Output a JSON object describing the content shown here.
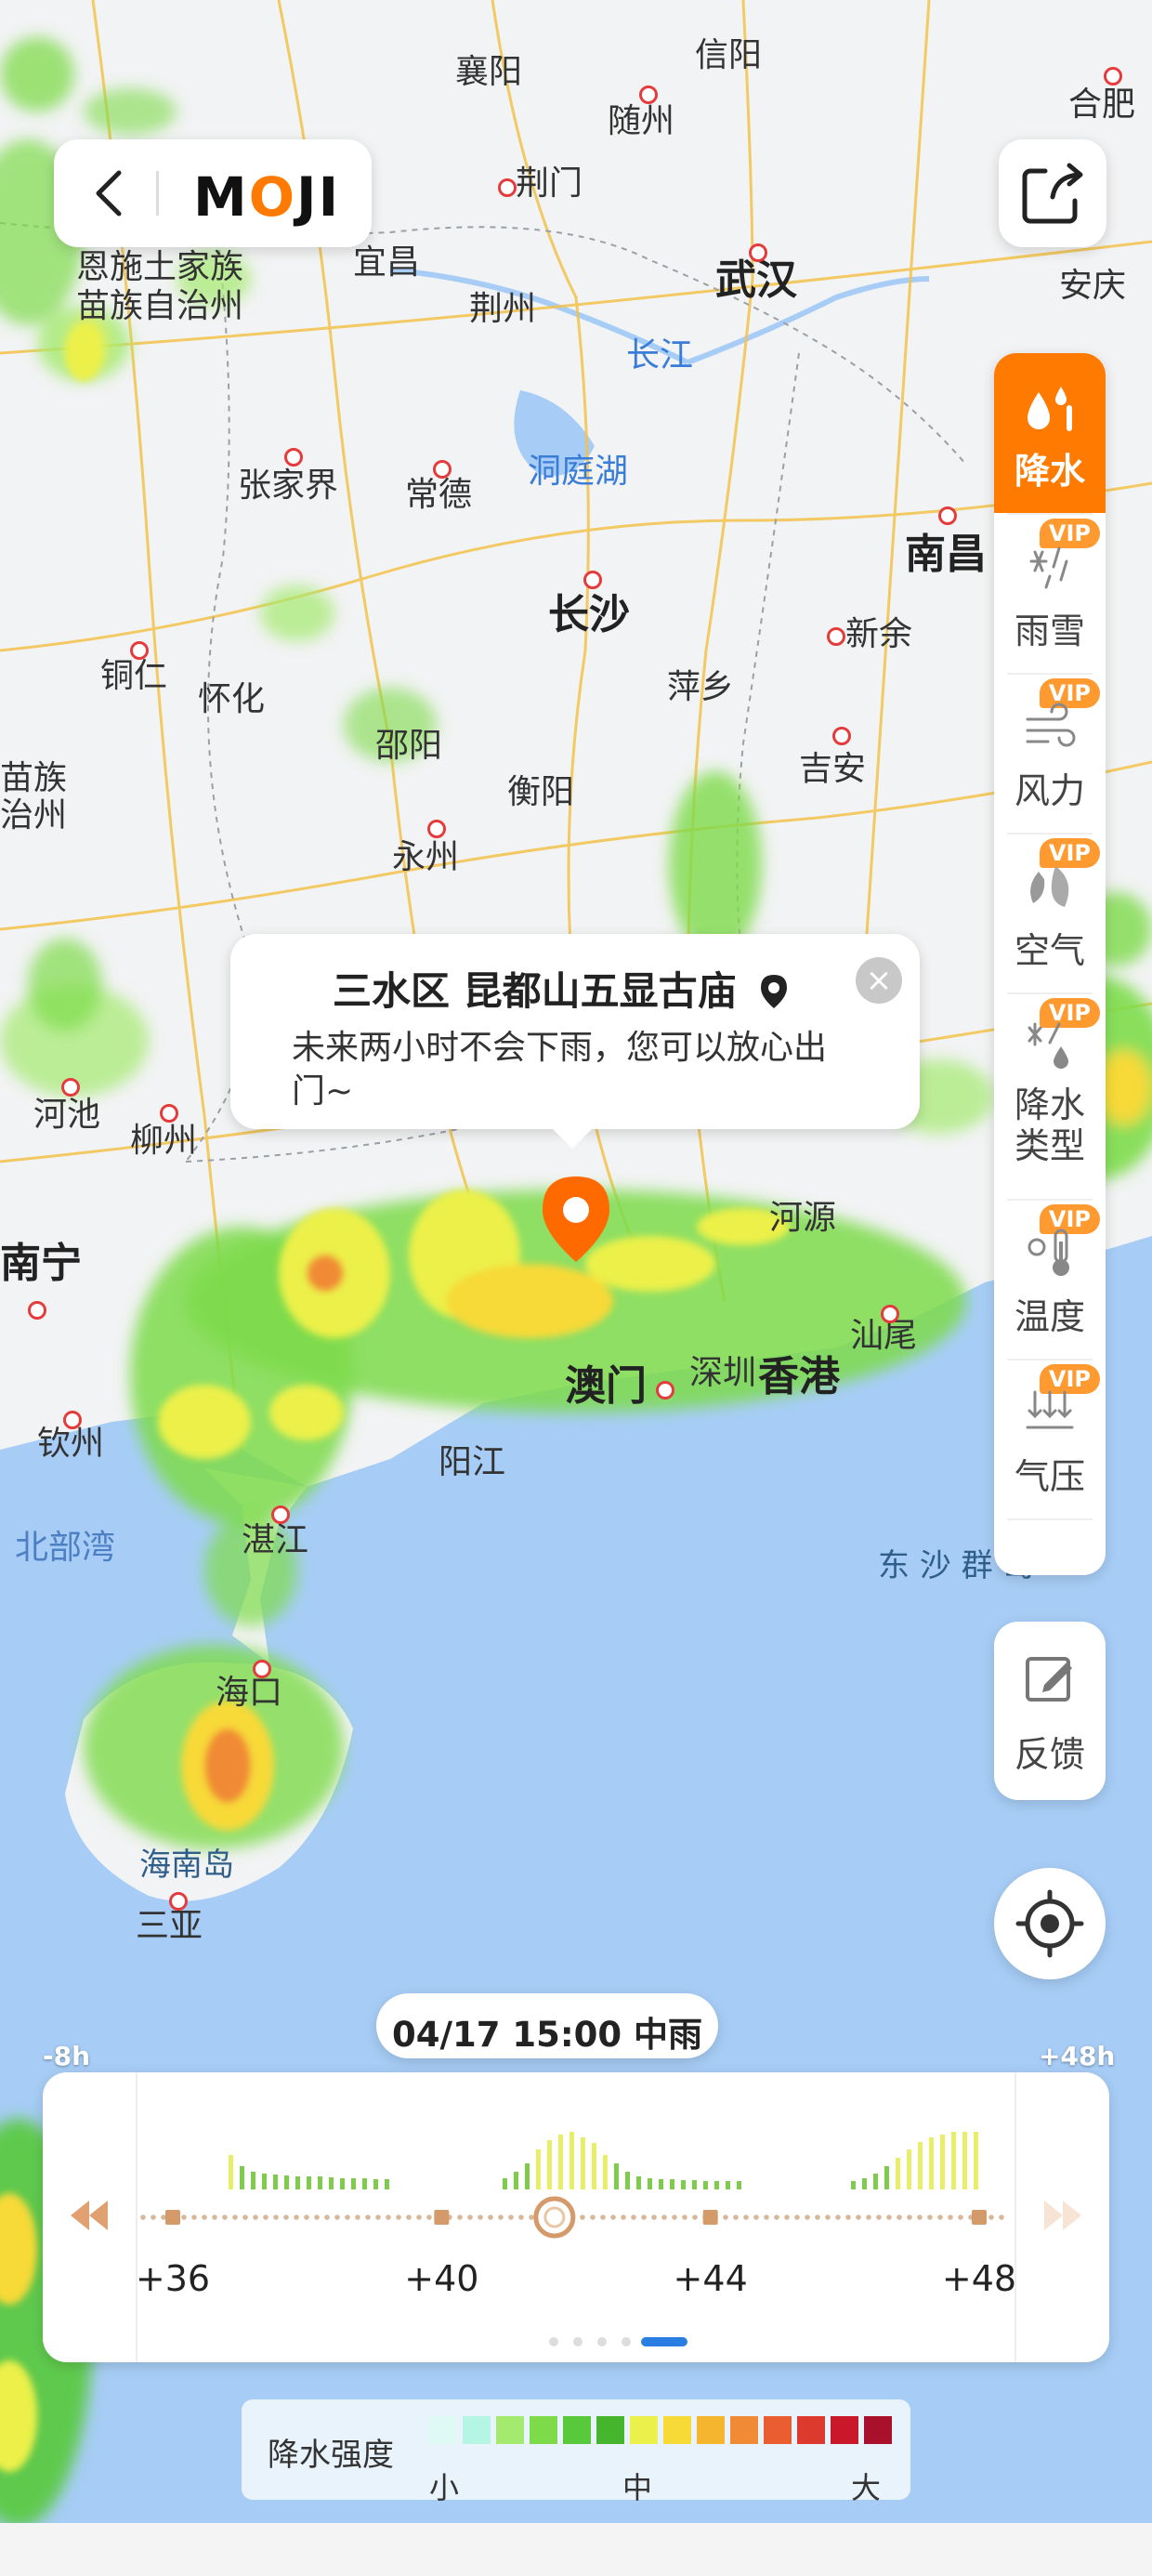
{
  "map": {
    "labels": [
      {
        "id": "xiangyang",
        "text": "襄阳",
        "dot": false
      },
      {
        "id": "xinyang",
        "text": "信阳",
        "dot": false
      },
      {
        "id": "suizhou",
        "text": "随州",
        "dot": true
      },
      {
        "id": "hefei",
        "text": "合肥",
        "dot": true
      },
      {
        "id": "enshi1",
        "text": "恩施土家族",
        "dot": false
      },
      {
        "id": "enshi2",
        "text": "苗族自治州",
        "dot": false
      },
      {
        "id": "yichang",
        "text": "宜昌",
        "dot": false
      },
      {
        "id": "jingmen",
        "text": "荆门",
        "dot": true
      },
      {
        "id": "jingzhou",
        "text": "荆州",
        "dot": false
      },
      {
        "id": "wuhan",
        "text": "武汉",
        "dot": true,
        "big": true
      },
      {
        "id": "anqing",
        "text": "安庆",
        "dot": false
      },
      {
        "id": "changjiang",
        "text": "长江",
        "water": true
      },
      {
        "id": "zhangjiajie",
        "text": "张家界",
        "dot": true
      },
      {
        "id": "changde",
        "text": "常德",
        "dot": true
      },
      {
        "id": "dongtinghu",
        "text": "洞庭湖",
        "water": true
      },
      {
        "id": "nanchang",
        "text": "南昌",
        "dot": true,
        "big": true
      },
      {
        "id": "changsha",
        "text": "长沙",
        "dot": true,
        "big": true
      },
      {
        "id": "xinyu",
        "text": "新余",
        "dot": true
      },
      {
        "id": "tongren",
        "text": "铜仁",
        "dot": true
      },
      {
        "id": "huaihua",
        "text": "怀化",
        "dot": false
      },
      {
        "id": "pingxiang",
        "text": "萍乡",
        "dot": false
      },
      {
        "id": "shaoyang",
        "text": "邵阳",
        "dot": false
      },
      {
        "id": "hengyang",
        "text": "衡阳",
        "dot": false
      },
      {
        "id": "jian",
        "text": "吉安",
        "dot": true
      },
      {
        "id": "miaozu1",
        "text": "苗族",
        "dot": false
      },
      {
        "id": "miaozu2",
        "text": "治州",
        "dot": false
      },
      {
        "id": "yongzhou",
        "text": "永州",
        "dot": true
      },
      {
        "id": "hechi",
        "text": "河池",
        "dot": true
      },
      {
        "id": "liuzhou",
        "text": "柳州",
        "dot": true
      },
      {
        "id": "heyuan",
        "text": "河源",
        "dot": false
      },
      {
        "id": "nanning",
        "text": "南宁",
        "dot": true,
        "big": true
      },
      {
        "id": "shantou",
        "text": "汕尾",
        "dot": true
      },
      {
        "id": "aomen",
        "text": "澳门",
        "dot": false,
        "big": true
      },
      {
        "id": "shenzhen",
        "text": "深圳",
        "dot": true
      },
      {
        "id": "xianggang",
        "text": "香港",
        "dot": false,
        "big": true
      },
      {
        "id": "qinzhou",
        "text": "钦州",
        "dot": true
      },
      {
        "id": "yangjiang",
        "text": "阳江",
        "dot": false
      },
      {
        "id": "beibuwan",
        "text": "北部湾",
        "sea": true
      },
      {
        "id": "zhanjiang",
        "text": "湛江",
        "dot": true
      },
      {
        "id": "dongsha",
        "text": "东 沙 群 岛",
        "island": true
      },
      {
        "id": "haikou",
        "text": "海口",
        "dot": true
      },
      {
        "id": "hainandao",
        "text": "海南岛",
        "island": true
      },
      {
        "id": "sanya",
        "text": "三亚",
        "dot": true
      }
    ]
  },
  "header": {
    "logo_text_1": "M",
    "logo_text_2": "O",
    "logo_text_3": "JI"
  },
  "layers": [
    {
      "label": "降水",
      "vip": false,
      "active": true,
      "icon": "rain-drop-icon"
    },
    {
      "label": "雨雪",
      "vip": true,
      "active": false,
      "icon": "rain-snow-icon"
    },
    {
      "label": "风力",
      "vip": true,
      "active": false,
      "icon": "wind-icon"
    },
    {
      "label": "空气",
      "vip": true,
      "active": false,
      "icon": "leaf-icon"
    },
    {
      "label": "降水\n类型",
      "vip": true,
      "active": false,
      "icon": "precip-type-icon"
    },
    {
      "label": "温度",
      "vip": true,
      "active": false,
      "icon": "thermometer-icon"
    },
    {
      "label": "气压",
      "vip": true,
      "active": false,
      "icon": "pressure-icon"
    }
  ],
  "vip_badge": "VIP",
  "feedback_label": "反馈",
  "popup": {
    "title": "三水区 昆都山五显古庙",
    "message": "未来两小时不会下雨，您可以放心出门~"
  },
  "timeline": {
    "current": "04/17 15:00  中雨",
    "range_start": "-8h",
    "range_end": "+48h",
    "ticks": [
      "+36",
      "+40",
      "+44",
      "+48"
    ],
    "pages": 5,
    "active_page": 5
  },
  "legend": {
    "title": "降水强度",
    "scale_low": "小",
    "scale_mid": "中",
    "scale_high": "大",
    "colors": [
      "#dffaf5",
      "#b4f5e4",
      "#a4ea6e",
      "#7ddb4a",
      "#57c93a",
      "#44b52c",
      "#ecf04a",
      "#f7d938",
      "#f5b52e",
      "#f08a34",
      "#ea5d30",
      "#dc3a2c",
      "#c8182a",
      "#a9102a"
    ]
  }
}
